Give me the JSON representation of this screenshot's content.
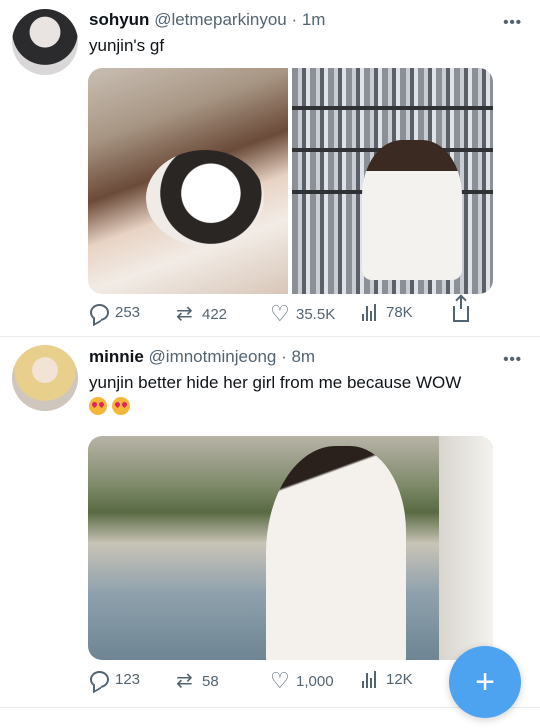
{
  "tweets": [
    {
      "name": "sohyun",
      "handle": "@letmeparkinyou",
      "time": "· 1m",
      "text": "yunjin's gf",
      "stats": {
        "replies": "253",
        "retweets": "422",
        "likes": "35.5K",
        "views": "78K"
      }
    },
    {
      "name": "minnie",
      "handle": "@imnotminjeong",
      "time": "· 8m",
      "text": "yunjin better hide her girl from me because WOW",
      "emojis": [
        "heart-eyes-emoji",
        "heart-eyes-emoji"
      ],
      "stats": {
        "replies": "123",
        "retweets": "58",
        "likes": "1,000",
        "views": "12K"
      }
    }
  ],
  "compose": {
    "icon": "plus-icon",
    "symbol": "+"
  },
  "colors": {
    "accent": "#4da3f0",
    "secondary_text": "#536471",
    "divider": "#e6ecf0"
  }
}
